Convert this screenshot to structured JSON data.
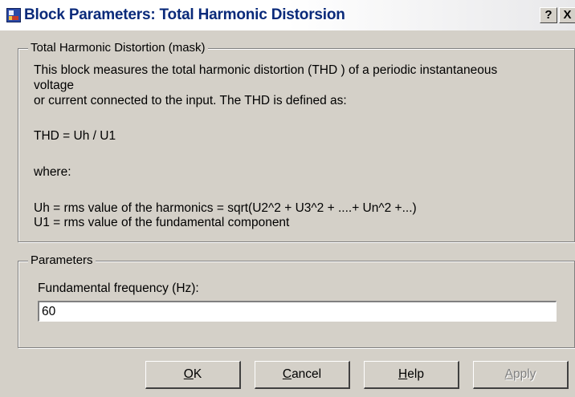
{
  "window": {
    "title": "Block Parameters: Total Harmonic Distorsion",
    "help_button": "?",
    "close_button": "X"
  },
  "description_group": {
    "legend": "Total Harmonic Distortion (mask)",
    "lines": [
      "This block measures the total harmonic distortion  (THD ) of a periodic instantaneous",
      "voltage",
      "or current connected to the input. The THD is defined as:",
      "THD = Uh / U1",
      "where:",
      "Uh = rms value of the harmonics = sqrt(U2^2 + U3^2 + ....+ Un^2 +...)",
      "U1 = rms value of the fundamental component"
    ]
  },
  "parameters_group": {
    "legend": "Parameters",
    "fundamental_frequency_label": "Fundamental frequency (Hz):",
    "fundamental_frequency_value": "60"
  },
  "buttons": {
    "ok": {
      "mnemonic": "O",
      "rest": "K"
    },
    "cancel": {
      "mnemonic": "C",
      "rest": "ancel"
    },
    "help": {
      "mnemonic": "H",
      "rest": "elp"
    },
    "apply": {
      "mnemonic": "A",
      "rest": "pply",
      "enabled": false
    }
  }
}
